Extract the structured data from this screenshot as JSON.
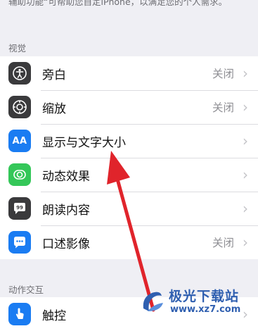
{
  "intro_text": "辅助功能“可帮助您自定iPhone，以满足您的个人需求。",
  "vision": {
    "header": "视觉",
    "items": [
      {
        "label": "旁白",
        "value": "关闭",
        "icon": "voiceover-icon"
      },
      {
        "label": "缩放",
        "value": "关闭",
        "icon": "zoom-icon"
      },
      {
        "label": "显示与文字大小",
        "value": "",
        "icon": "text-size-icon",
        "icon_text": "AA"
      },
      {
        "label": "动态效果",
        "value": "",
        "icon": "motion-icon"
      },
      {
        "label": "朗读内容",
        "value": "",
        "icon": "spoken-content-icon"
      },
      {
        "label": "口述影像",
        "value": "关闭",
        "icon": "audio-description-icon"
      }
    ]
  },
  "interaction": {
    "header": "动作交互",
    "items": [
      {
        "label": "触控",
        "value": "",
        "icon": "touch-icon"
      }
    ]
  },
  "watermark": {
    "title": "极光下载站",
    "url": "www.xz7.com"
  },
  "colors": {
    "dark_icon": "#3a3a3c",
    "blue_icon": "#1a7cf2",
    "green_icon": "#34c759",
    "arrow": "#e0242b"
  }
}
